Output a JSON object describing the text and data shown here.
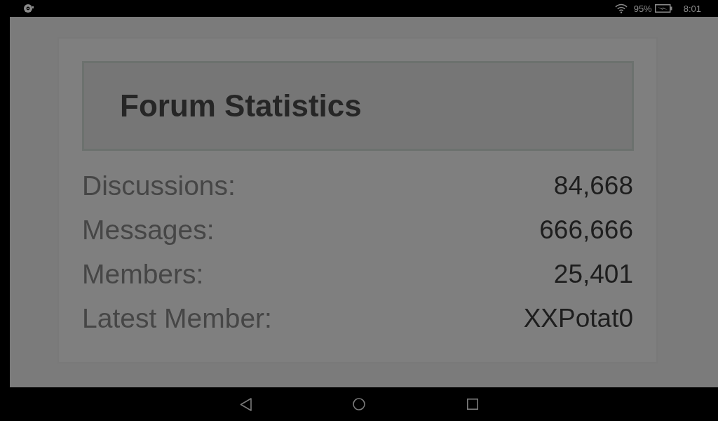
{
  "status_bar": {
    "battery_percent": "95%",
    "charging": true,
    "time": "8:01"
  },
  "forum_statistics": {
    "title": "Forum Statistics",
    "rows": [
      {
        "label": "Discussions:",
        "value": "84,668"
      },
      {
        "label": "Messages:",
        "value": "666,666"
      },
      {
        "label": "Members:",
        "value": "25,401"
      },
      {
        "label": "Latest Member:",
        "value": "XXPotat0"
      }
    ]
  }
}
